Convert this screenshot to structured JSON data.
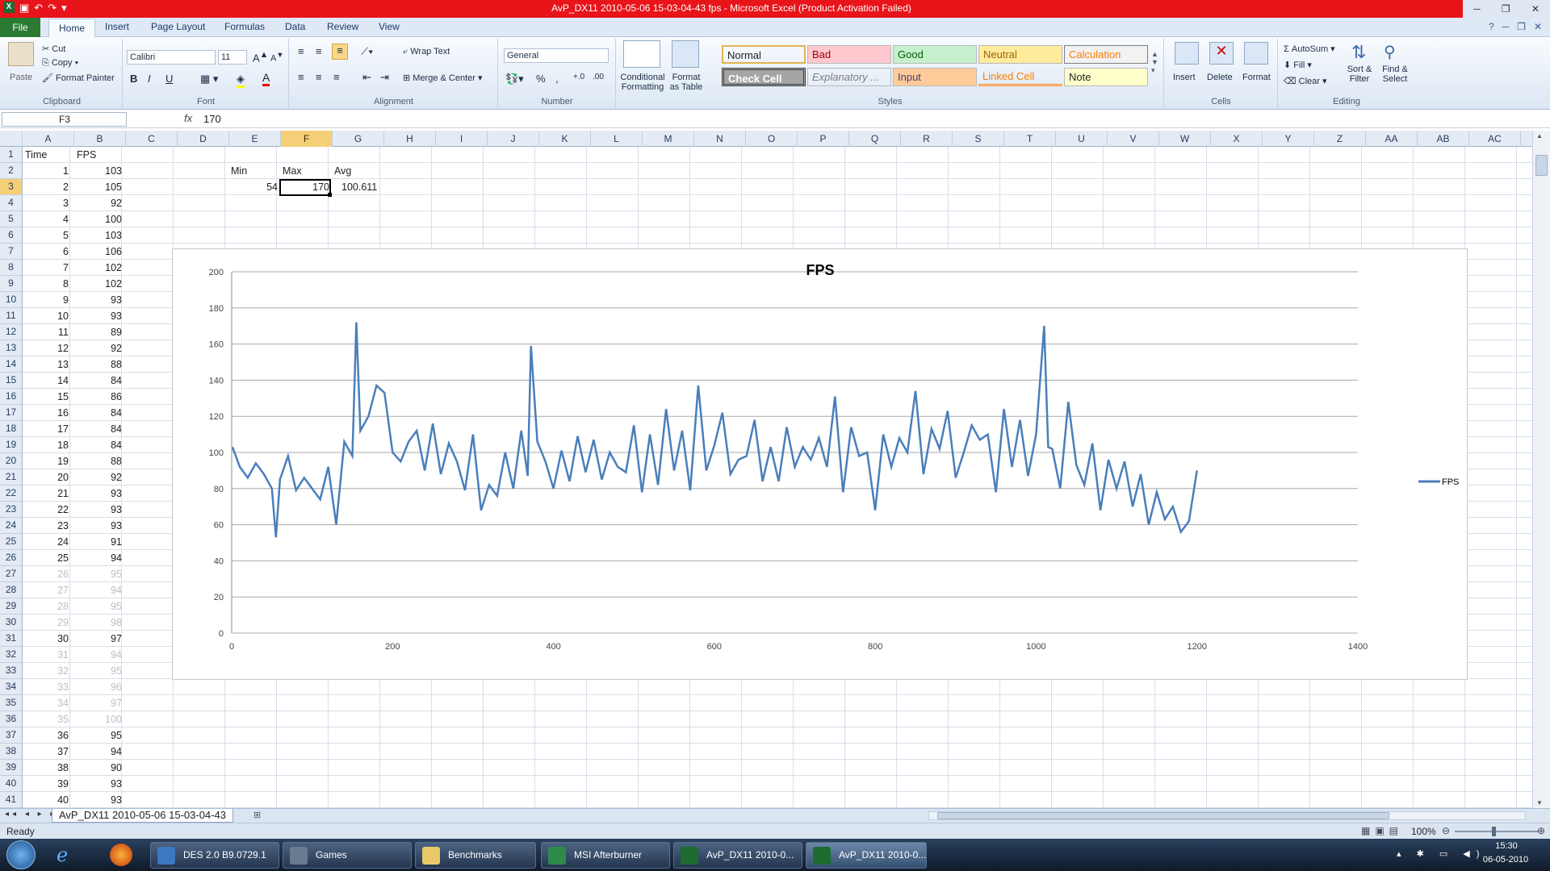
{
  "window": {
    "title": "AvP_DX11 2010-05-06 15-03-04-43 fps  -  Microsoft Excel (Product Activation Failed)"
  },
  "ribbon_tabs": [
    "File",
    "Home",
    "Insert",
    "Page Layout",
    "Formulas",
    "Data",
    "Review",
    "View"
  ],
  "ribbon": {
    "clipboard": {
      "paste": "Paste",
      "cut": "Cut",
      "copy": "Copy",
      "format_painter": "Format Painter",
      "label": "Clipboard"
    },
    "font": {
      "name": "Calibri",
      "size": "11",
      "label": "Font"
    },
    "alignment": {
      "wrap": "Wrap Text",
      "merge": "Merge & Center",
      "label": "Alignment"
    },
    "number": {
      "format": "General",
      "label": "Number"
    },
    "styles": {
      "conditional": "Conditional Formatting",
      "format_table": "Format as Table",
      "cells": [
        {
          "label": "Normal",
          "bg": "#ffffff",
          "fg": "#000000"
        },
        {
          "label": "Bad",
          "bg": "#ffc7ce",
          "fg": "#9c0006"
        },
        {
          "label": "Good",
          "bg": "#c6efce",
          "fg": "#006100"
        },
        {
          "label": "Neutral",
          "bg": "#ffeb9c",
          "fg": "#9c6500"
        },
        {
          "label": "Calculation",
          "bg": "#f2f2f2",
          "fg": "#fa7d00"
        },
        {
          "label": "Check Cell",
          "bg": "#a5a5a5",
          "fg": "#ffffff"
        },
        {
          "label": "Explanatory ...",
          "bg": "#ffffff",
          "fg": "#7f7f7f"
        },
        {
          "label": "Input",
          "bg": "#ffcc99",
          "fg": "#3f3f76"
        },
        {
          "label": "Linked Cell",
          "bg": "#ffffff",
          "fg": "#fa7d00"
        },
        {
          "label": "Note",
          "bg": "#ffffcc",
          "fg": "#000000"
        }
      ],
      "label": "Styles"
    },
    "cells": {
      "insert": "Insert",
      "delete": "Delete",
      "format": "Format",
      "label": "Cells"
    },
    "editing": {
      "autosum": "AutoSum",
      "fill": "Fill",
      "clear": "Clear",
      "sort": "Sort & Filter",
      "find": "Find & Select",
      "label": "Editing"
    }
  },
  "formula_bar": {
    "name_box": "F3",
    "fx": "fx",
    "value": "170"
  },
  "columns": [
    "A",
    "B",
    "C",
    "D",
    "E",
    "F",
    "G",
    "H",
    "I",
    "J",
    "K",
    "L",
    "M",
    "N",
    "O",
    "P",
    "Q",
    "R",
    "S",
    "T",
    "U",
    "V",
    "W",
    "X",
    "Y",
    "Z",
    "AA",
    "AB",
    "AC"
  ],
  "rows": [
    "1",
    "2",
    "3",
    "4",
    "5",
    "6",
    "7",
    "8",
    "9",
    "10",
    "11",
    "12",
    "13",
    "14",
    "15",
    "16",
    "17",
    "18",
    "19",
    "20",
    "21",
    "22",
    "23",
    "24",
    "25",
    "26",
    "27",
    "28",
    "29",
    "30",
    "31",
    "32",
    "33",
    "34",
    "35",
    "36",
    "37",
    "38",
    "39",
    "40",
    "41"
  ],
  "sheet": {
    "header_time": "Time",
    "header_fps": "FPS",
    "time_values": [
      "1",
      "2",
      "3",
      "4",
      "5",
      "6",
      "7",
      "8",
      "9",
      "10",
      "11",
      "12",
      "13",
      "14",
      "15",
      "16",
      "17",
      "18",
      "19",
      "20",
      "21",
      "22",
      "23",
      "24",
      "25",
      "26",
      "27",
      "28",
      "29",
      "30",
      "31",
      "32",
      "33",
      "34",
      "35",
      "36",
      "37",
      "38",
      "39",
      "40"
    ],
    "fps_values": [
      "103",
      "105",
      "92",
      "100",
      "103",
      "106",
      "102",
      "102",
      "93",
      "93",
      "89",
      "92",
      "88",
      "84",
      "86",
      "84",
      "84",
      "84",
      "88",
      "92",
      "93",
      "93",
      "93",
      "91",
      "94",
      "95",
      "94",
      "95",
      "98",
      "97",
      "94",
      "95",
      "96",
      "97",
      "100",
      "95",
      "94",
      "90",
      "93",
      "93"
    ],
    "stats_labels": {
      "min": "Min",
      "max": "Max",
      "avg": "Avg"
    },
    "stats_values": {
      "min": "54",
      "max": "170",
      "avg": "100.611"
    }
  },
  "chart_data": {
    "type": "line",
    "title": "FPS",
    "xlabel": "",
    "ylabel": "",
    "xlim": [
      0,
      1400
    ],
    "ylim": [
      0,
      200
    ],
    "x_ticks": [
      "0",
      "200",
      "400",
      "600",
      "800",
      "1000",
      "1200",
      "1400"
    ],
    "y_ticks": [
      "0",
      "20",
      "40",
      "60",
      "80",
      "100",
      "120",
      "140",
      "160",
      "180",
      "200"
    ],
    "grid": true,
    "legend_position": "right",
    "series": [
      {
        "name": "FPS",
        "color": "#4a7ebb",
        "x": [
          1,
          10,
          20,
          30,
          40,
          50,
          55,
          60,
          70,
          80,
          90,
          100,
          110,
          120,
          130,
          140,
          150,
          155,
          160,
          170,
          180,
          190,
          200,
          210,
          220,
          230,
          240,
          250,
          260,
          270,
          280,
          290,
          300,
          310,
          320,
          330,
          340,
          350,
          360,
          368,
          372,
          380,
          390,
          400,
          410,
          420,
          430,
          440,
          450,
          460,
          470,
          480,
          490,
          500,
          510,
          520,
          530,
          540,
          550,
          560,
          570,
          580,
          590,
          600,
          610,
          620,
          630,
          640,
          650,
          660,
          670,
          680,
          690,
          700,
          710,
          720,
          730,
          740,
          750,
          760,
          770,
          780,
          790,
          800,
          810,
          820,
          830,
          840,
          850,
          860,
          870,
          880,
          890,
          900,
          910,
          920,
          930,
          940,
          950,
          960,
          970,
          980,
          990,
          1000,
          1010,
          1015,
          1020,
          1030,
          1040,
          1050,
          1060,
          1070,
          1080,
          1090,
          1100,
          1110,
          1120,
          1130,
          1140,
          1150,
          1160,
          1170,
          1180,
          1190,
          1200
        ],
        "values": [
          103,
          92,
          86,
          94,
          88,
          80,
          53,
          85,
          98,
          79,
          86,
          80,
          74,
          92,
          60,
          106,
          98,
          172,
          112,
          120,
          137,
          133,
          100,
          95,
          106,
          112,
          90,
          116,
          88,
          105,
          95,
          79,
          110,
          68,
          82,
          76,
          100,
          80,
          112,
          87,
          159,
          106,
          95,
          80,
          101,
          84,
          109,
          89,
          107,
          85,
          100,
          92,
          89,
          115,
          78,
          110,
          82,
          124,
          90,
          112,
          79,
          137,
          90,
          104,
          122,
          88,
          96,
          98,
          118,
          84,
          103,
          84,
          114,
          92,
          103,
          96,
          108,
          92,
          131,
          78,
          114,
          98,
          100,
          68,
          110,
          92,
          108,
          100,
          134,
          88,
          113,
          102,
          123,
          86,
          100,
          115,
          107,
          110,
          78,
          124,
          92,
          118,
          87,
          110,
          170,
          103,
          102,
          80,
          128,
          93,
          82,
          105,
          68,
          96,
          80,
          95,
          70,
          88,
          60,
          78,
          63,
          70,
          56,
          62,
          90
        ]
      }
    ]
  },
  "sheet_tab": "AvP_DX11 2010-05-06 15-03-04-43",
  "status": {
    "ready": "Ready",
    "zoom": "100%"
  },
  "taskbar": {
    "items": [
      "DES 2.0 B9.0729.1",
      "Games",
      "Benchmarks",
      "MSI Afterburner",
      "AvP_DX11 2010-0...",
      "AvP_DX11 2010-0..."
    ],
    "time": "15:30",
    "date": "06-05-2010"
  }
}
